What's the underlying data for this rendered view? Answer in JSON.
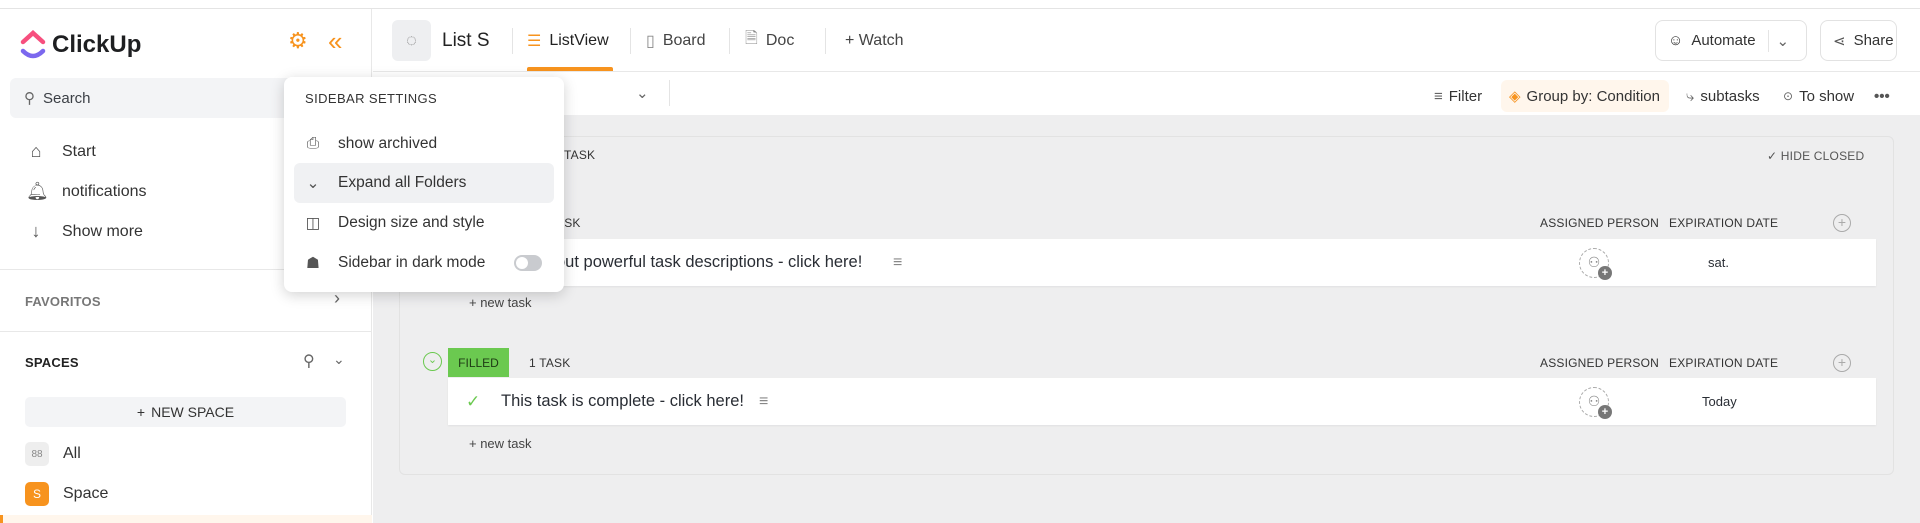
{
  "sidebar": {
    "logo": "ClickUp",
    "search_placeholder": "Search",
    "nav": [
      {
        "label": "Start",
        "icon": "home-icon"
      },
      {
        "label": "notifications",
        "icon": "bell-icon"
      },
      {
        "label": "Show more",
        "icon": "arrow-down-icon"
      }
    ],
    "favorites": "FAVORITOS",
    "spaces": "SPACES",
    "new_space": "NEW SPACE",
    "items": [
      {
        "label": "All",
        "badge": "88"
      },
      {
        "label": "Space",
        "badge": "S"
      }
    ]
  },
  "popup": {
    "title": "SIDEBAR SETTINGS",
    "items": [
      {
        "label": "show archived",
        "icon": "archive-icon"
      },
      {
        "label": "Expand all Folders",
        "icon": "chevron-down-icon"
      },
      {
        "label": "Design size and style",
        "icon": "layout-icon"
      },
      {
        "label": "Sidebar in dark mode",
        "icon": "dark-mode-icon",
        "toggle": false
      }
    ]
  },
  "header": {
    "list_name": "List S",
    "tabs": [
      {
        "label": "ListView",
        "active": true
      },
      {
        "label": "Board"
      },
      {
        "label": "Doc"
      },
      {
        "label": "+ Watch"
      }
    ],
    "automate": "Automate",
    "share": "Share"
  },
  "toolbar": {
    "filter": "Filter",
    "group_by": "Group by: Condition",
    "subtasks": "subtasks",
    "to_show": "To show"
  },
  "groups": [
    {
      "status": "",
      "count": "TASK",
      "header_partial": "ASK",
      "hide_closed": "HIDE CLOSED",
      "columns": [
        "ASSIGNED PERSON",
        "EXPIRATION DATE"
      ],
      "tasks": [
        {
          "name": "out powerful task descriptions - click here!",
          "date": "sat."
        }
      ],
      "new_task": "+ new task"
    },
    {
      "status": "FILLED",
      "count": "1 TASK",
      "status_color": "#6bc950",
      "columns": [
        "ASSIGNED PERSON",
        "EXPIRATION DATE"
      ],
      "tasks": [
        {
          "name": "This task is complete - click here!",
          "date": "Today"
        }
      ],
      "new_task": "+ new task"
    }
  ],
  "colors": {
    "accent": "#f7931e",
    "filled": "#6bc950"
  }
}
